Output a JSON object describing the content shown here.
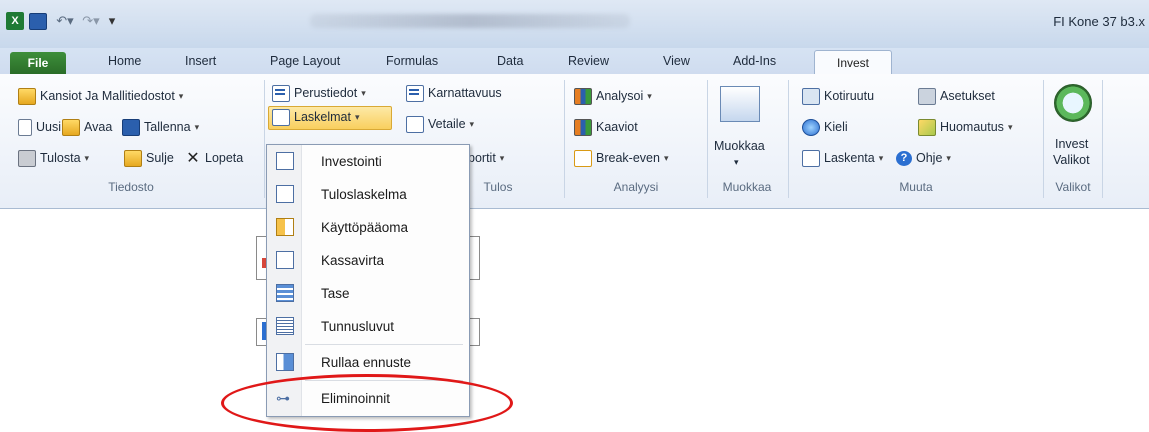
{
  "window": {
    "title": "FI Kone 37 b3.x"
  },
  "qat": {
    "save_tip": "Save",
    "undo_tip": "Undo",
    "redo_tip": "Redo",
    "customize_tip": "Customize"
  },
  "tabs": {
    "file": "File",
    "home": "Home",
    "insert": "Insert",
    "page_layout": "Page Layout",
    "formulas": "Formulas",
    "data": "Data",
    "review": "Review",
    "view": "View",
    "add_ins": "Add-Ins",
    "invest": "Invest"
  },
  "ribbon": {
    "tiedosto": {
      "label": "Tiedosto",
      "kansiot": "Kansiot Ja Mallitiedostot",
      "uusi": "Uusi",
      "avaa": "Avaa",
      "tallenna": "Tallenna",
      "tulosta": "Tulosta",
      "sulje": "Sulje",
      "lopeta": "Lopeta"
    },
    "tulos": {
      "label": "Tulos",
      "perustiedot": "Perustiedot",
      "laskelmat": "Laskelmat",
      "kannattavuus_a": "Kar",
      "kannattavuus_b": "nattavuus",
      "vertaile_a": "Ve",
      "vertaile_b": "taile",
      "raportit": "portit"
    },
    "analyysi": {
      "label": "Analyysi",
      "analysoi": "Analysoi",
      "kaaviot": "Kaaviot",
      "break_even": "Break-even"
    },
    "muokkaa": {
      "label": "Muokkaa",
      "button": "Muokkaa"
    },
    "muuta": {
      "label": "Muuta",
      "kotiruutu": "Kotiruutu",
      "asetukset": "Asetukset",
      "kieli": "Kieli",
      "huomautus": "Huomautus",
      "laskenta": "Laskenta",
      "ohje": "Ohje"
    },
    "valikot": {
      "label": "Valikot",
      "invest_line1": "Invest",
      "invest_line2": "Valikot"
    }
  },
  "menu": {
    "items": [
      {
        "label": "Investointi"
      },
      {
        "label": "Tuloslaskelma"
      },
      {
        "label": "Käyttöpääoma"
      },
      {
        "label": "Kassavirta"
      },
      {
        "label": "Tase"
      },
      {
        "label": "Tunnusluvut"
      },
      {
        "label": "Rullaa ennuste"
      },
      {
        "label": "Eliminoinnit"
      }
    ]
  },
  "colors": {
    "highlight": "#e01818",
    "file_tab": "#2a6d28",
    "selected_button": "#f9cf5e"
  }
}
